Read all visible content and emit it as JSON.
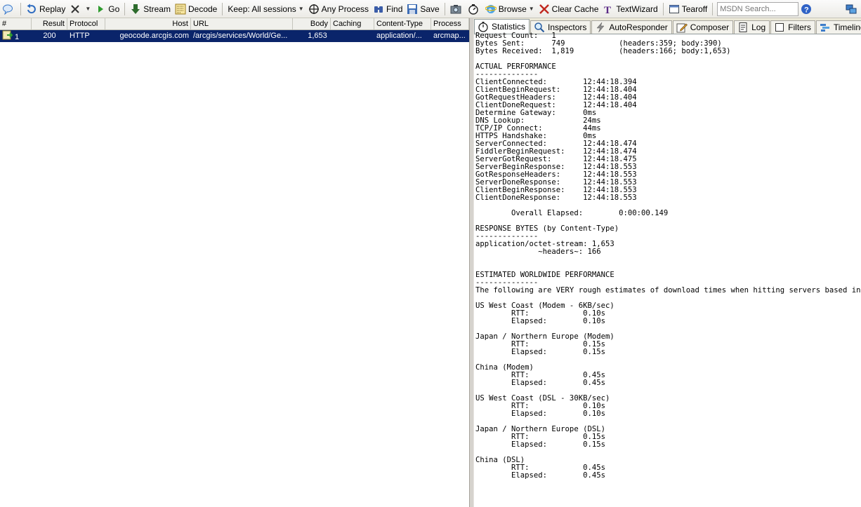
{
  "toolbar": {
    "replay": "Replay",
    "go": "Go",
    "stream": "Stream",
    "decode": "Decode",
    "keep": "Keep: All sessions",
    "any_process": "Any Process",
    "find": "Find",
    "save": "Save",
    "browse": "Browse",
    "clear_cache": "Clear Cache",
    "textwizard": "TextWizard",
    "tearoff": "Tearoff",
    "msdn_placeholder": "MSDN Search..."
  },
  "sessions": {
    "columns": [
      "#",
      "Result",
      "Protocol",
      "Host",
      "URL",
      "Body",
      "Caching",
      "Content-Type",
      "Process"
    ],
    "rows": [
      {
        "num": "1",
        "result": "200",
        "protocol": "HTTP",
        "host": "geocode.arcgis.com",
        "url": "/arcgis/services/World/Ge...",
        "body": "1,653",
        "caching": "",
        "content_type": "application/...",
        "process": "arcmap..."
      }
    ]
  },
  "tabs": [
    "Statistics",
    "Inspectors",
    "AutoResponder",
    "Composer",
    "Log",
    "Filters",
    "Timeline"
  ],
  "statistics_text": "Request Count:   1\nBytes Sent:      749\t\t(headers:359; body:390)\nBytes Received:  1,819\t\t(headers:166; body:1,653)\n\nACTUAL PERFORMANCE\n--------------\nClientConnected:\t12:44:18.394\nClientBeginRequest:\t12:44:18.404\nGotRequestHeaders:\t12:44:18.404\nClientDoneRequest:\t12:44:18.404\nDetermine Gateway:\t0ms\nDNS Lookup: \t\t24ms\nTCP/IP Connect:\t\t44ms\nHTTPS Handshake:\t0ms\nServerConnected:\t12:44:18.474\nFiddlerBeginRequest:\t12:44:18.474\nServerGotRequest:\t12:44:18.475\nServerBeginResponse:\t12:44:18.553\nGotResponseHeaders:\t12:44:18.553\nServerDoneResponse:\t12:44:18.553\nClientBeginResponse:\t12:44:18.553\nClientDoneResponse:\t12:44:18.553\n\n\tOverall Elapsed:\t0:00:00.149\n\nRESPONSE BYTES (by Content-Type)\n--------------\napplication/octet-stream: 1,653\n              ~headers~: 166\n\n\nESTIMATED WORLDWIDE PERFORMANCE\n--------------\nThe following are VERY rough estimates of download times when hitting servers based in Seattle.\n\nUS West Coast (Modem - 6KB/sec)\n\tRTT:\t\t0.10s\n\tElapsed:\t0.10s\n\nJapan / Northern Europe (Modem)\n\tRTT:\t\t0.15s\n\tElapsed:\t0.15s\n\nChina (Modem)\n\tRTT:\t\t0.45s\n\tElapsed:\t0.45s\n\nUS West Coast (DSL - 30KB/sec)\n\tRTT:\t\t0.10s\n\tElapsed:\t0.10s\n\nJapan / Northern Europe (DSL)\n\tRTT:\t\t0.15s\n\tElapsed:\t0.15s\n\nChina (DSL)\n\tRTT:\t\t0.45s\n\tElapsed:\t0.45s",
  "colors": {
    "selection": "#0a246a",
    "toolbar_bg": "#ecebe6",
    "splitter": "#d6d3ce"
  }
}
